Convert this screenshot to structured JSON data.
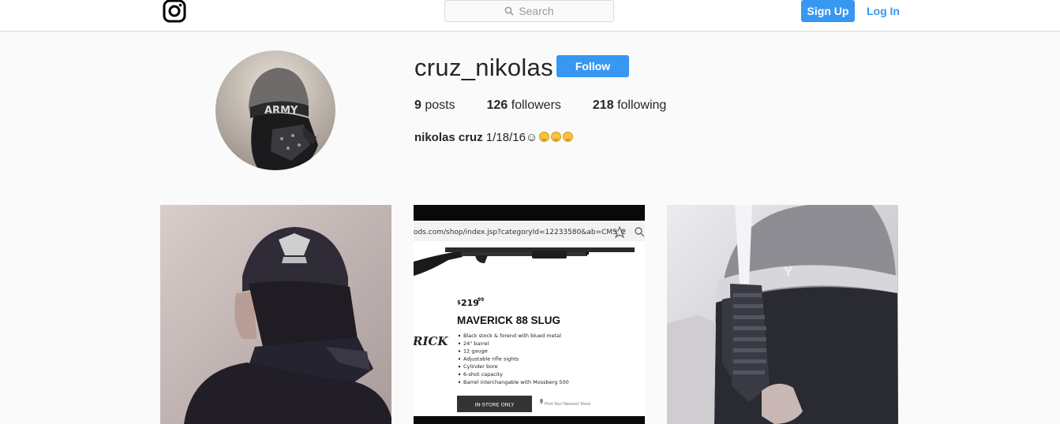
{
  "nav": {
    "logo_icon": "instagram-glyph-icon",
    "search_placeholder": "Search",
    "search_icon": "magnifier-icon",
    "signup_label": "Sign Up",
    "login_label": "Log In"
  },
  "profile": {
    "username": "cruz_nikolas",
    "follow_label": "Follow",
    "stats": {
      "posts_count": "9",
      "posts_label": "posts",
      "followers_count": "126",
      "followers_label": "followers",
      "following_count": "218",
      "following_label": "following"
    },
    "bio": {
      "full_name": "nikolas cruz",
      "text": "1/18/16☺"
    }
  },
  "posts": {
    "post2": {
      "url_bar": "ods.com/shop/index.jsp?categoryId=12233580&ab=CMS_C",
      "price_dollar": "$",
      "price_main": "219",
      "price_cents": "99",
      "product_title": "MAVERICK 88 SLUG",
      "brand_fragment": "RICK",
      "features": [
        "Black stock & forend with blued metal",
        "24\" barrel",
        "12 gauge",
        "Adjustable rifle sights",
        "Cylinder bore",
        "6-shot capacity",
        "Barrel interchangable with Mossberg 500"
      ],
      "in_store_label": "IN-STORE ONLY",
      "find_store_label": "Find Your Nearest Store"
    },
    "post3": {
      "hat_letter": "Y"
    },
    "avatar_hat_text": "ARMY"
  },
  "colors": {
    "accent": "#3897f0",
    "background": "#fafafa",
    "border": "#dbdbdb",
    "text": "#262626"
  }
}
